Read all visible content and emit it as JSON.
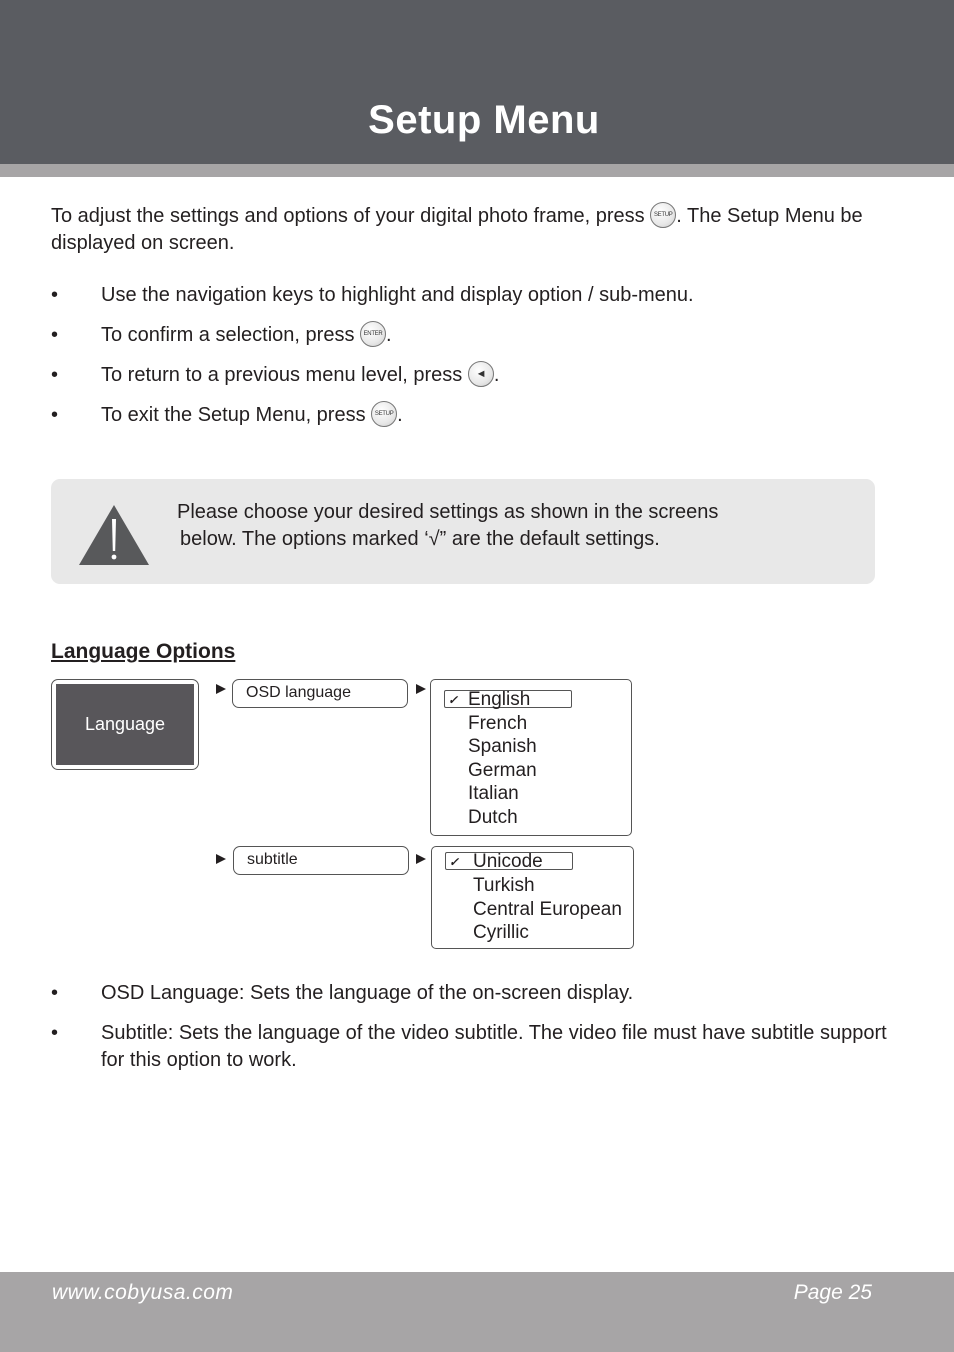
{
  "header": {
    "title": "Setup Menu"
  },
  "intro": {
    "text_before": "To adjust the settings and options of your digital photo frame, press ",
    "button": "SETUP",
    "text_after": ". The Setup Menu be displayed on screen."
  },
  "bullets": [
    {
      "text_before": "Use the navigation keys to highlight and display option / sub-menu.",
      "button": null,
      "text_after": ""
    },
    {
      "text_before": "To confirm a selection, press ",
      "button": "ENTER",
      "text_after": "."
    },
    {
      "text_before": "To return to a previous menu level, press ",
      "button": "◄",
      "text_after": "."
    },
    {
      "text_before": "To exit the Setup Menu, press ",
      "button": "SETUP",
      "text_after": "."
    }
  ],
  "bullet_symbol": "•",
  "note": {
    "icon": "warning-icon",
    "line1": "Please choose your desired settings as shown in the screens",
    "line2": "below. The options marked ‘√” are the default settings."
  },
  "section": {
    "title": "Language Options",
    "menu_label": "Language",
    "submenus": [
      {
        "label": "OSD language",
        "options": [
          "English",
          "French",
          "Spanish",
          "German",
          "Italian",
          "Dutch"
        ],
        "default": "English"
      },
      {
        "label": "subtitle",
        "options": [
          "Unicode",
          "Turkish",
          "Central European",
          "Cyrillic"
        ],
        "default": "Unicode"
      }
    ],
    "check_mark": "✓"
  },
  "descriptions": [
    "OSD Language: Sets the language of the on-screen display.",
    "Subtitle: Sets the language of the video subtitle. The video file must have subtitle support for this option to work."
  ],
  "footer": {
    "url": "www.cobyusa.com",
    "page": "Page 25"
  },
  "colors": {
    "header_bg": "#5a5c61",
    "stripe": "#a7a5a6",
    "note_bg": "#e8e8e8",
    "menu_bg": "#58565a"
  }
}
